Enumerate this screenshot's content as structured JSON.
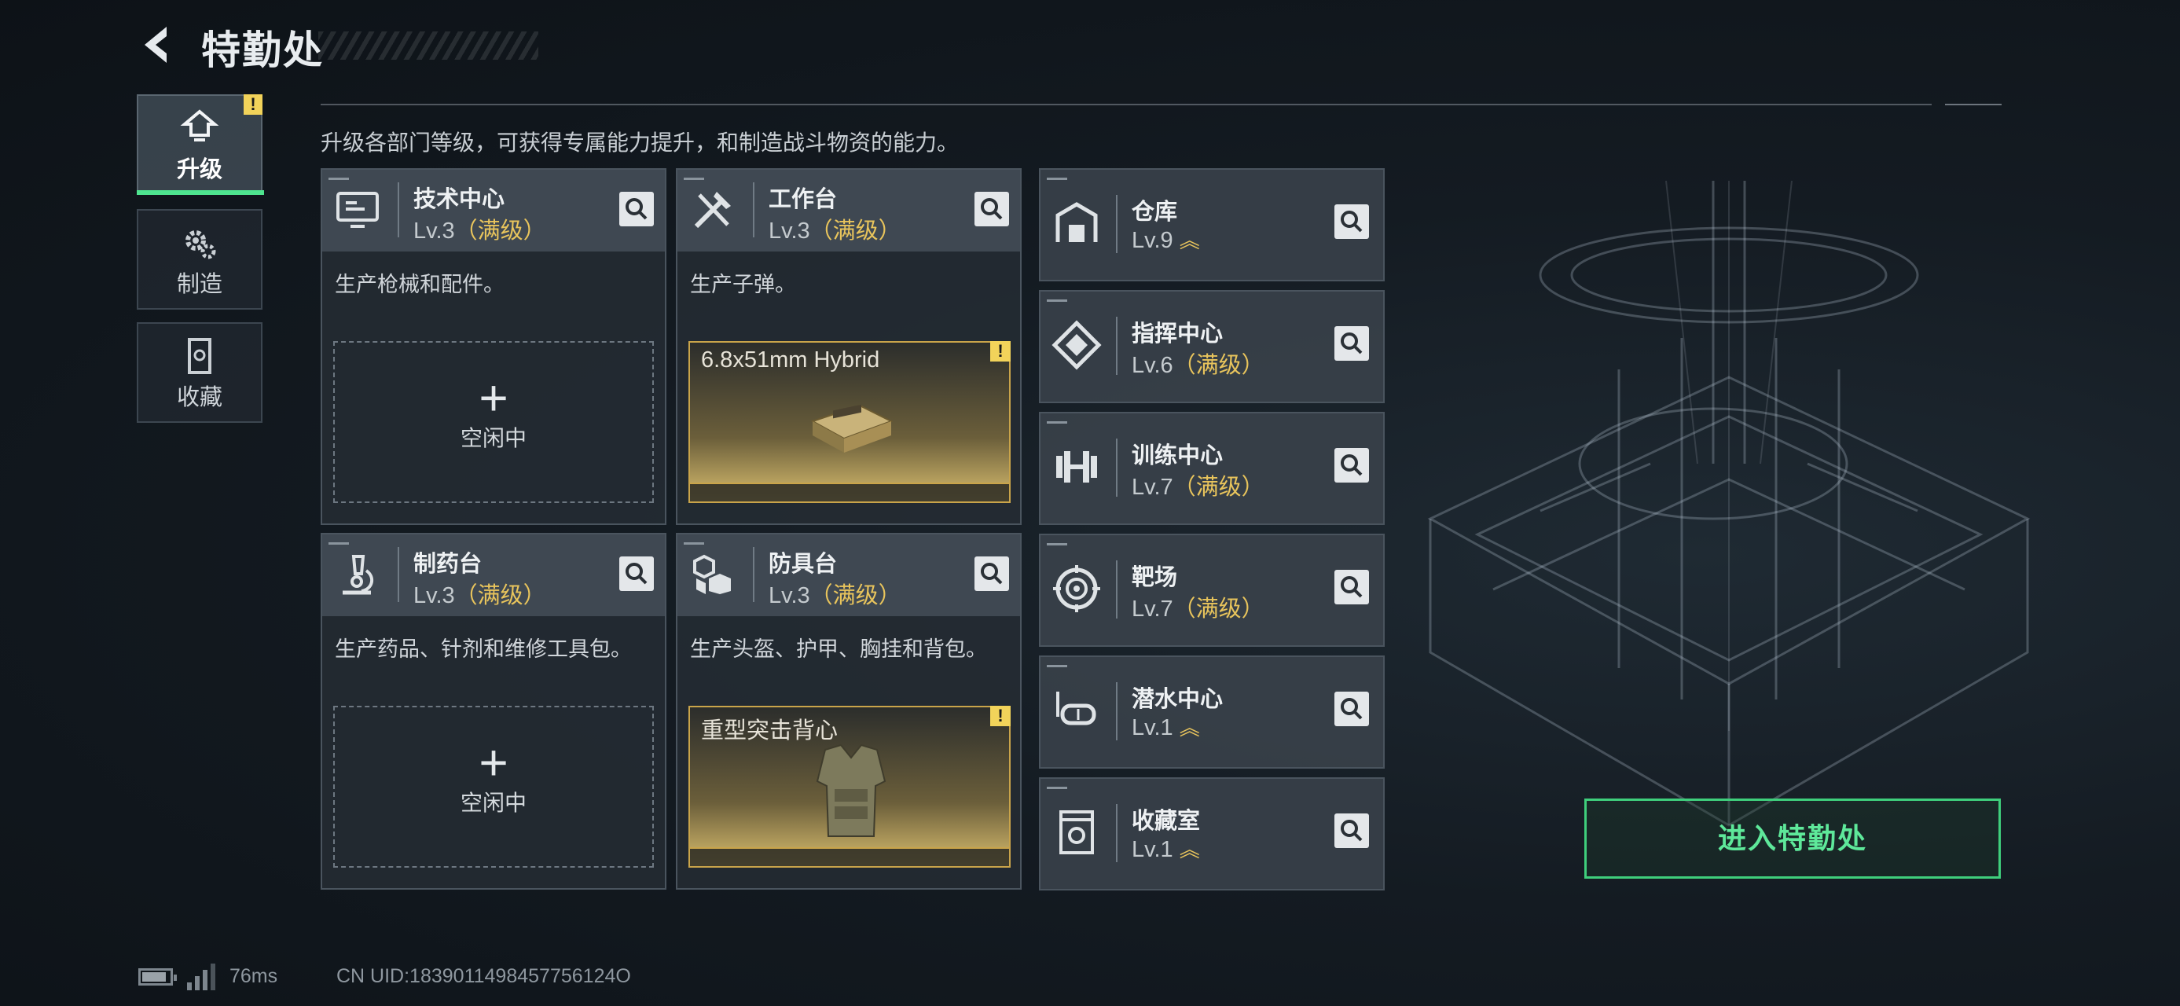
{
  "header": {
    "title": "特勤处"
  },
  "nav": {
    "tabs": [
      {
        "label": "升级",
        "icon": "upgrade-icon",
        "active": true,
        "badge": "!"
      },
      {
        "label": "制造",
        "icon": "gear-icon",
        "active": false
      },
      {
        "label": "收藏",
        "icon": "collection-icon",
        "active": false
      }
    ]
  },
  "intro": "升级各部门等级，可获得专属能力提升，和制造战斗物资的能力。",
  "big_cards": [
    {
      "name": "技术中心",
      "level": "Lv.3",
      "max": "（满级）",
      "icon": "computer-icon",
      "desc": "生产枪械和配件。",
      "slot": {
        "type": "idle",
        "plus": "+",
        "label": "空闲中"
      }
    },
    {
      "name": "工作台",
      "level": "Lv.3",
      "max": "（满级）",
      "icon": "tools-icon",
      "desc": "生产子弹。",
      "slot": {
        "type": "producing",
        "item": "6.8x51mm Hybrid",
        "badge": "!"
      }
    },
    {
      "name": "制药台",
      "level": "Lv.3",
      "max": "（满级）",
      "icon": "microscope-icon",
      "desc": "生产药品、针剂和维修工具包。",
      "slot": {
        "type": "idle",
        "plus": "+",
        "label": "空闲中"
      }
    },
    {
      "name": "防具台",
      "level": "Lv.3",
      "max": "（满级）",
      "icon": "cubes-icon",
      "desc": "生产头盔、护甲、胸挂和背包。",
      "slot": {
        "type": "producing",
        "item": "重型突击背心",
        "badge": "!"
      }
    }
  ],
  "small_cards": [
    {
      "name": "仓库",
      "level": "Lv.9",
      "max": "",
      "upgradable": true,
      "icon": "warehouse-icon"
    },
    {
      "name": "指挥中心",
      "level": "Lv.6",
      "max": "（满级）",
      "upgradable": false,
      "icon": "command-icon"
    },
    {
      "name": "训练中心",
      "level": "Lv.7",
      "max": "（满级）",
      "upgradable": false,
      "icon": "dumbbell-icon"
    },
    {
      "name": "靶场",
      "level": "Lv.7",
      "max": "（满级）",
      "upgradable": false,
      "icon": "target-icon"
    },
    {
      "name": "潜水中心",
      "level": "Lv.1",
      "max": "",
      "upgradable": true,
      "icon": "diving-mask-icon"
    },
    {
      "name": "收藏室",
      "level": "Lv.1",
      "max": "",
      "upgradable": true,
      "icon": "collection-room-icon"
    }
  ],
  "enter_button": "进入特勤处",
  "status": {
    "ping": "76ms",
    "uid": "CN UID:1839011498457756124O"
  },
  "colors": {
    "accent": "#4ee48f",
    "max_level": "#e8c45c",
    "warning": "#f2d35a"
  }
}
